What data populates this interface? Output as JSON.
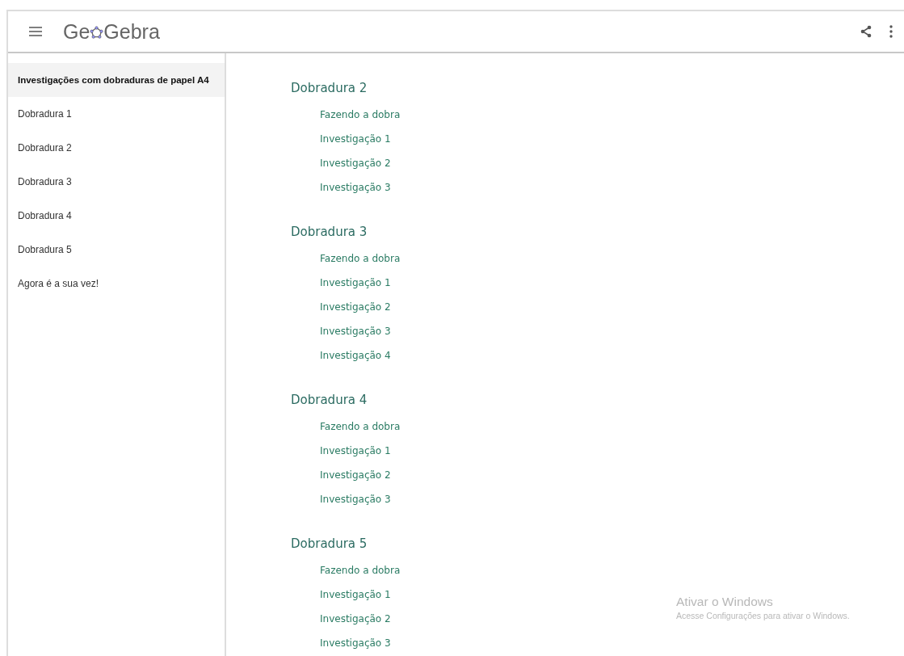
{
  "header": {
    "logo": {
      "before": "Ge",
      "after": "Gebra"
    }
  },
  "sidebar": {
    "items": [
      {
        "label": "Investigações com dobraduras de papel A4",
        "selected": true
      },
      {
        "label": "Dobradura 1",
        "selected": false
      },
      {
        "label": "Dobradura 2",
        "selected": false
      },
      {
        "label": "Dobradura 3",
        "selected": false
      },
      {
        "label": "Dobradura 4",
        "selected": false
      },
      {
        "label": "Dobradura 5",
        "selected": false
      },
      {
        "label": "Agora é a sua vez!",
        "selected": false
      }
    ]
  },
  "sections": [
    {
      "title": "Dobradura 2",
      "links": [
        "Fazendo a dobra",
        "Investigação 1",
        "Investigação 2",
        "Investigação 3"
      ]
    },
    {
      "title": "Dobradura 3",
      "links": [
        "Fazendo a dobra",
        "Investigação 1",
        "Investigação 2",
        "Investigação 3",
        "Investigação 4"
      ]
    },
    {
      "title": "Dobradura 4",
      "links": [
        "Fazendo a dobra",
        "Investigação 1",
        "Investigação 2",
        "Investigação 3"
      ]
    },
    {
      "title": "Dobradura 5",
      "links": [
        "Fazendo a dobra",
        "Investigação 1",
        "Investigação 2",
        "Investigação 3"
      ]
    }
  ],
  "activation_notice": {
    "title": "Ativar o Windows",
    "message": "Acesse Configurações para ativar o Windows."
  }
}
